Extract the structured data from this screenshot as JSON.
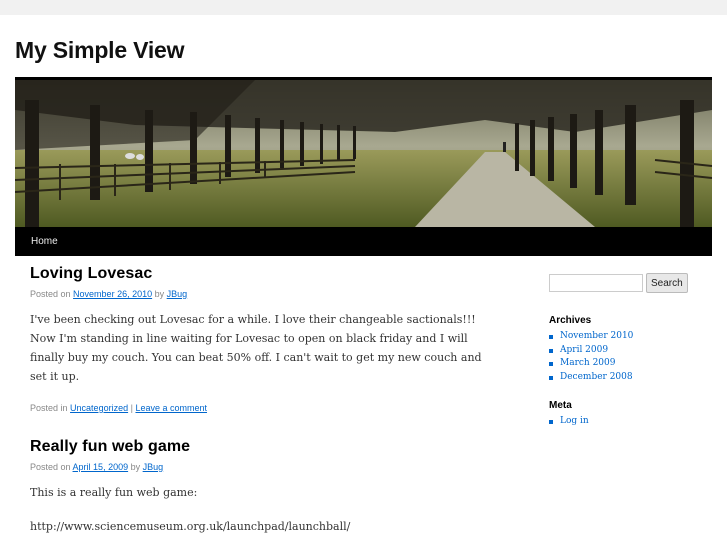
{
  "site": {
    "title": "My Simple View"
  },
  "nav": {
    "home": "Home"
  },
  "posts": [
    {
      "title": "Loving Lovesac",
      "posted_on_label": "Posted on",
      "date": "November 26, 2010",
      "by_label": "by",
      "author": "JBug",
      "body": "I've been checking out Lovesac for a while. I love their changeable sactionals!!! Now I'm standing in line waiting for Lovesac to open on black friday and I will finally buy my couch. You can beat 50% off. I can't wait to get my new couch and set it up.",
      "posted_in_label": "Posted in",
      "category": "Uncategorized",
      "separator": "|",
      "comment_link": "Leave a comment"
    },
    {
      "title": "Really fun web game",
      "posted_on_label": "Posted on",
      "date": "April 15, 2009",
      "by_label": "by",
      "author": "JBug",
      "body": "This is a really fun web game:",
      "link_text": "http://www.sciencemuseum.org.uk/launchpad/launchball/"
    }
  ],
  "sidebar": {
    "search_placeholder": "",
    "search_button": "Search",
    "archives_title": "Archives",
    "archives": [
      "November 2010",
      "April 2009",
      "March 2009",
      "December 2008"
    ],
    "meta_title": "Meta",
    "meta_links": [
      "Log in"
    ]
  }
}
